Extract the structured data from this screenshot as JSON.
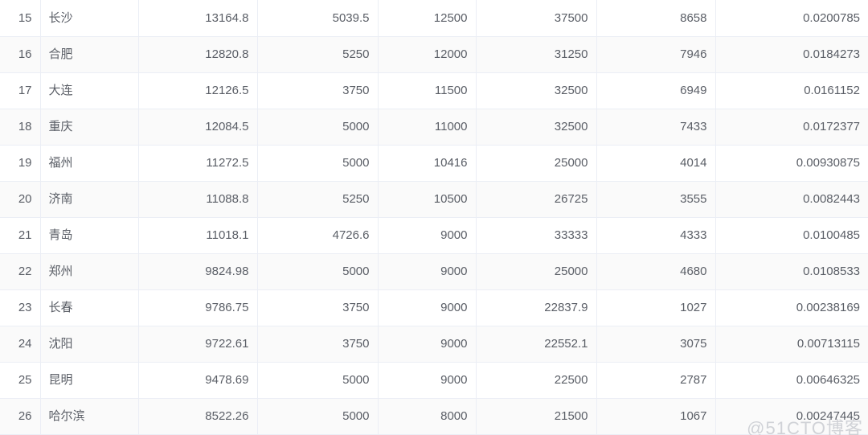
{
  "table": {
    "columns": [
      {
        "key": "index",
        "align": "right"
      },
      {
        "key": "city",
        "align": "left"
      },
      {
        "key": "m1",
        "align": "right"
      },
      {
        "key": "m2",
        "align": "right"
      },
      {
        "key": "m3",
        "align": "right"
      },
      {
        "key": "m4",
        "align": "right"
      },
      {
        "key": "m5",
        "align": "right"
      },
      {
        "key": "m6",
        "align": "right"
      }
    ],
    "rows": [
      {
        "index": "15",
        "city": "长沙",
        "m1": "13164.8",
        "m2": "5039.5",
        "m3": "12500",
        "m4": "37500",
        "m5": "8658",
        "m6": "0.0200785"
      },
      {
        "index": "16",
        "city": "合肥",
        "m1": "12820.8",
        "m2": "5250",
        "m3": "12000",
        "m4": "31250",
        "m5": "7946",
        "m6": "0.0184273"
      },
      {
        "index": "17",
        "city": "大连",
        "m1": "12126.5",
        "m2": "3750",
        "m3": "11500",
        "m4": "32500",
        "m5": "6949",
        "m6": "0.0161152"
      },
      {
        "index": "18",
        "city": "重庆",
        "m1": "12084.5",
        "m2": "5000",
        "m3": "11000",
        "m4": "32500",
        "m5": "7433",
        "m6": "0.0172377"
      },
      {
        "index": "19",
        "city": "福州",
        "m1": "11272.5",
        "m2": "5000",
        "m3": "10416",
        "m4": "25000",
        "m5": "4014",
        "m6": "0.00930875"
      },
      {
        "index": "20",
        "city": "济南",
        "m1": "11088.8",
        "m2": "5250",
        "m3": "10500",
        "m4": "26725",
        "m5": "3555",
        "m6": "0.0082443"
      },
      {
        "index": "21",
        "city": "青岛",
        "m1": "11018.1",
        "m2": "4726.6",
        "m3": "9000",
        "m4": "33333",
        "m5": "4333",
        "m6": "0.0100485"
      },
      {
        "index": "22",
        "city": "郑州",
        "m1": "9824.98",
        "m2": "5000",
        "m3": "9000",
        "m4": "25000",
        "m5": "4680",
        "m6": "0.0108533"
      },
      {
        "index": "23",
        "city": "长春",
        "m1": "9786.75",
        "m2": "3750",
        "m3": "9000",
        "m4": "22837.9",
        "m5": "1027",
        "m6": "0.00238169"
      },
      {
        "index": "24",
        "city": "沈阳",
        "m1": "9722.61",
        "m2": "3750",
        "m3": "9000",
        "m4": "22552.1",
        "m5": "3075",
        "m6": "0.00713115"
      },
      {
        "index": "25",
        "city": "昆明",
        "m1": "9478.69",
        "m2": "5000",
        "m3": "9000",
        "m4": "22500",
        "m5": "2787",
        "m6": "0.00646325"
      },
      {
        "index": "26",
        "city": "哈尔滨",
        "m1": "8522.26",
        "m2": "5000",
        "m3": "8000",
        "m4": "21500",
        "m5": "1067",
        "m6": "0.00247445"
      }
    ]
  },
  "watermark": {
    "text": "@51CTO博客"
  },
  "colors": {
    "text": "#5a5e66",
    "border": "#ebeef5",
    "row_alt_bg": "#fafafa",
    "row_bg": "#ffffff",
    "watermark": "#c9ccd1"
  }
}
